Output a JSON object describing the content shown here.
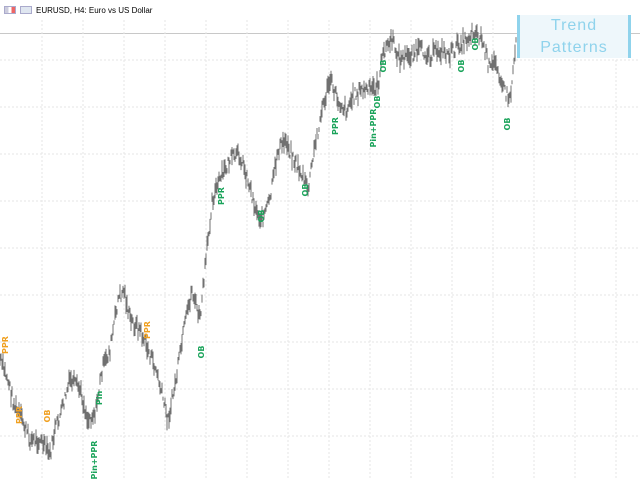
{
  "window": {
    "title": "EURUSD, H4:  Euro vs US Dollar",
    "flag_icons": [
      "eu-flag-icon",
      "us-flag-icon"
    ]
  },
  "indicator": {
    "title_line1": "Trend",
    "title_line2": "Patterns",
    "color": "#8fd3ec"
  },
  "colors": {
    "price": "#707070",
    "bullish": "#1aa35a",
    "bearish": "#f0a020",
    "grid": "#e6e6e6"
  },
  "pattern_labels": [
    {
      "text": "PPR",
      "kind": "bearish"
    },
    {
      "text": "PPR",
      "kind": "bearish"
    },
    {
      "text": "OB",
      "kind": "bearish"
    },
    {
      "text": "Pin+PPR",
      "kind": "bullish"
    },
    {
      "text": "Pin",
      "kind": "bullish"
    },
    {
      "text": "PPR",
      "kind": "bearish"
    },
    {
      "text": "OB",
      "kind": "bullish"
    },
    {
      "text": "PPR",
      "kind": "bullish"
    },
    {
      "text": "OB",
      "kind": "bullish"
    },
    {
      "text": "OB",
      "kind": "bullish"
    },
    {
      "text": "PPR",
      "kind": "bullish"
    },
    {
      "text": "Pin+PPR",
      "kind": "bullish"
    },
    {
      "text": "OB",
      "kind": "bullish"
    },
    {
      "text": "OB",
      "kind": "bullish"
    },
    {
      "text": "OB",
      "kind": "bullish"
    },
    {
      "text": "OB",
      "kind": "bullish"
    },
    {
      "text": "OB",
      "kind": "bullish"
    }
  ]
}
